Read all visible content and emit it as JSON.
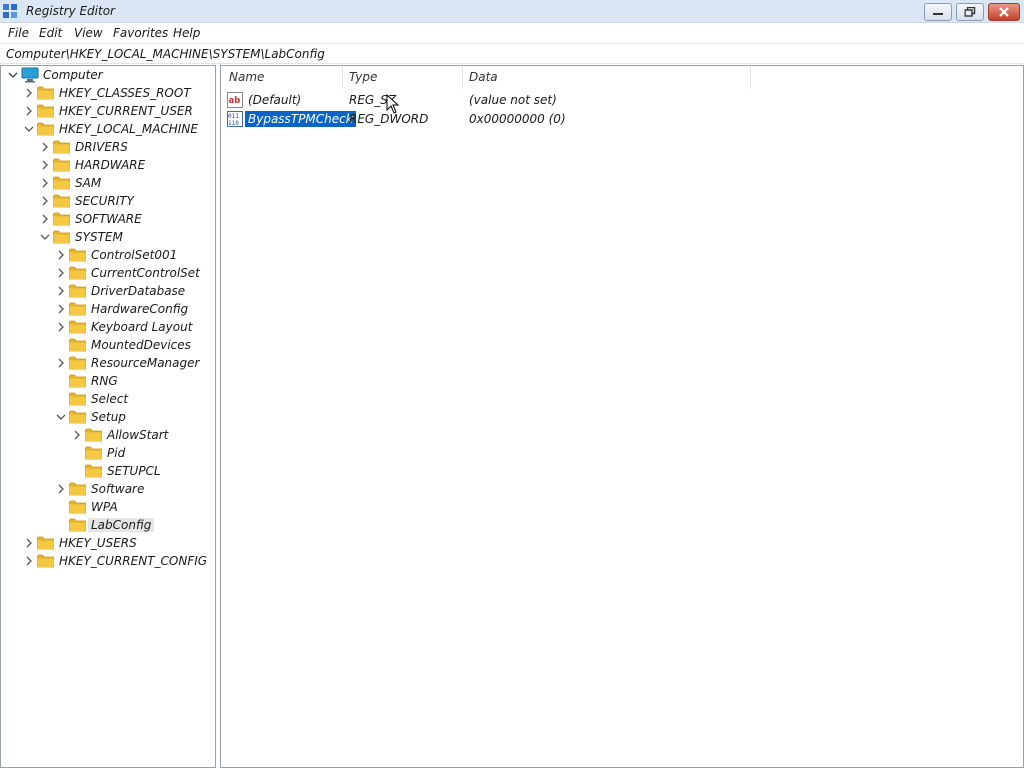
{
  "window": {
    "title": "Registry Editor",
    "icon": "regedit-icon"
  },
  "menu": {
    "items": [
      "File",
      "Edit",
      "View",
      "Favorites",
      "Help"
    ]
  },
  "address": {
    "path": "Computer\\HKEY_LOCAL_MACHINE\\SYSTEM\\LabConfig"
  },
  "tree": {
    "root": "Computer",
    "nodes": [
      {
        "label": "HKEY_CLASSES_ROOT",
        "level": 1,
        "expander": "collapsed"
      },
      {
        "label": "HKEY_CURRENT_USER",
        "level": 1,
        "expander": "collapsed"
      },
      {
        "label": "HKEY_LOCAL_MACHINE",
        "level": 1,
        "expander": "expanded"
      },
      {
        "label": "DRIVERS",
        "level": 2,
        "expander": "collapsed"
      },
      {
        "label": "HARDWARE",
        "level": 2,
        "expander": "collapsed"
      },
      {
        "label": "SAM",
        "level": 2,
        "expander": "collapsed"
      },
      {
        "label": "SECURITY",
        "level": 2,
        "expander": "collapsed"
      },
      {
        "label": "SOFTWARE",
        "level": 2,
        "expander": "collapsed"
      },
      {
        "label": "SYSTEM",
        "level": 2,
        "expander": "expanded"
      },
      {
        "label": "ControlSet001",
        "level": 3,
        "expander": "collapsed"
      },
      {
        "label": "CurrentControlSet",
        "level": 3,
        "expander": "collapsed"
      },
      {
        "label": "DriverDatabase",
        "level": 3,
        "expander": "collapsed"
      },
      {
        "label": "HardwareConfig",
        "level": 3,
        "expander": "collapsed"
      },
      {
        "label": "Keyboard Layout",
        "level": 3,
        "expander": "collapsed"
      },
      {
        "label": "MountedDevices",
        "level": 3,
        "expander": "none"
      },
      {
        "label": "ResourceManager",
        "level": 3,
        "expander": "collapsed"
      },
      {
        "label": "RNG",
        "level": 3,
        "expander": "none"
      },
      {
        "label": "Select",
        "level": 3,
        "expander": "none"
      },
      {
        "label": "Setup",
        "level": 3,
        "expander": "expanded"
      },
      {
        "label": "AllowStart",
        "level": 4,
        "expander": "collapsed"
      },
      {
        "label": "Pid",
        "level": 4,
        "expander": "none"
      },
      {
        "label": "SETUPCL",
        "level": 4,
        "expander": "none"
      },
      {
        "label": "Software",
        "level": 3,
        "expander": "collapsed"
      },
      {
        "label": "WPA",
        "level": 3,
        "expander": "none"
      },
      {
        "label": "LabConfig",
        "level": 3,
        "expander": "none",
        "selected": true
      },
      {
        "label": "HKEY_USERS",
        "level": 1,
        "expander": "collapsed"
      },
      {
        "label": "HKEY_CURRENT_CONFIG",
        "level": 1,
        "expander": "collapsed"
      }
    ]
  },
  "list": {
    "columns": [
      "Name",
      "Type",
      "Data"
    ],
    "rows": [
      {
        "name": "(Default)",
        "type": "REG_SZ",
        "data": "(value not set)",
        "icon": "string-value-icon",
        "selected": false
      },
      {
        "name": "BypassTPMCheck",
        "type": "REG_DWORD",
        "data": "0x00000000 (0)",
        "icon": "binary-value-icon",
        "selected": true
      }
    ]
  },
  "colors": {
    "titlebar": "#dbe6f4",
    "selection": "#0a64c8",
    "folder": "#f5c842",
    "tree_selected": "#e5e5e5"
  }
}
